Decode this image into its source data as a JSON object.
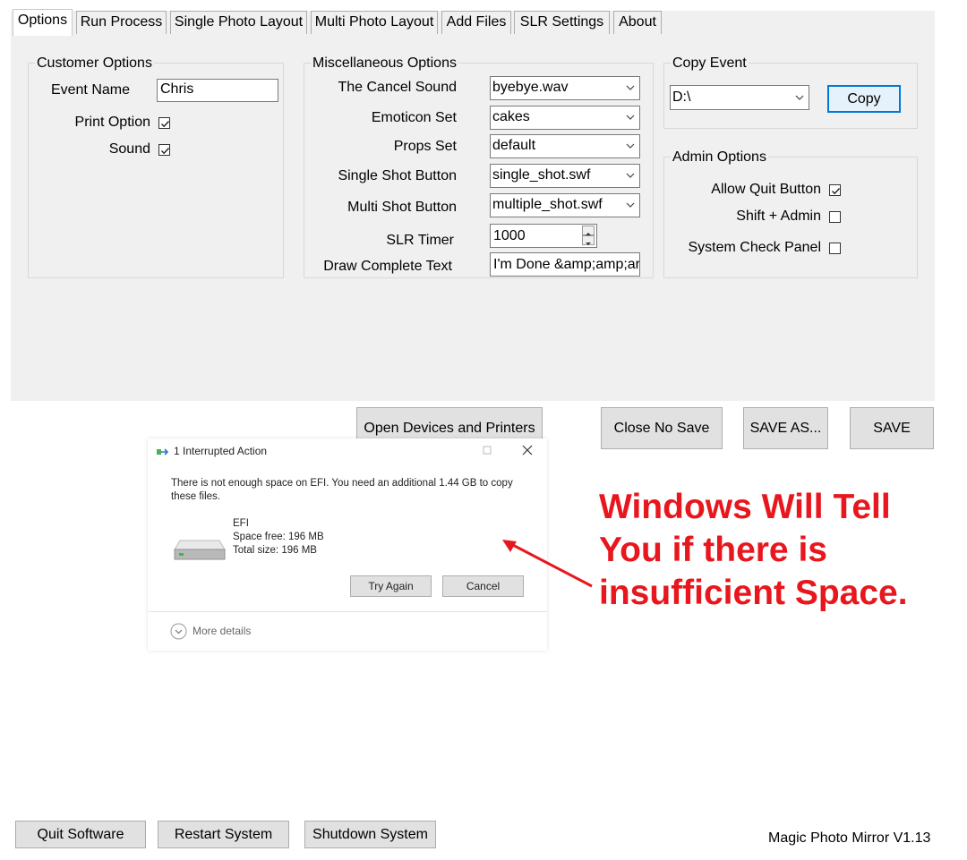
{
  "tabs": [
    {
      "label": "Options",
      "active": true
    },
    {
      "label": "Run Process"
    },
    {
      "label": "Single Photo Layout"
    },
    {
      "label": "Multi Photo Layout"
    },
    {
      "label": "Add Files"
    },
    {
      "label": "SLR Settings"
    },
    {
      "label": "About"
    }
  ],
  "customer_options": {
    "title": "Customer Options",
    "event_name_label": "Event Name",
    "event_name_value": "Chris",
    "print_option_label": "Print Option",
    "print_option_checked": true,
    "sound_label": "Sound",
    "sound_checked": true
  },
  "misc_options": {
    "title": "Miscellaneous Options",
    "cancel_sound_label": "The Cancel Sound",
    "cancel_sound_value": "byebye.wav",
    "emoticon_label": "Emoticon Set",
    "emoticon_value": "cakes",
    "props_label": "Props Set",
    "props_value": "default",
    "single_shot_label": "Single Shot Button",
    "single_shot_value": "single_shot.swf",
    "multi_shot_label": "Multi Shot Button",
    "multi_shot_value": "multiple_shot.swf",
    "slr_timer_label": "SLR Timer",
    "slr_timer_value": "1000",
    "draw_complete_label": "Draw Complete Text",
    "draw_complete_value": "I'm Done &amp;amp;ar"
  },
  "copy_event": {
    "title": "Copy Event",
    "drive_value": "D:\\",
    "copy_label": "Copy"
  },
  "admin_options": {
    "title": "Admin Options",
    "allow_quit_label": "Allow Quit Button",
    "allow_quit_checked": true,
    "shift_admin_label": "Shift + Admin",
    "shift_admin_checked": false,
    "system_check_label": "System Check Panel",
    "system_check_checked": false
  },
  "actions": {
    "open_devices_label": "Open Devices and Printers",
    "close_no_save_label": "Close No Save",
    "save_as_label": "SAVE AS...",
    "save_label": "SAVE"
  },
  "dialog": {
    "title": "1 Interrupted Action",
    "message": "There is not enough space on EFI. You need an additional 1.44 GB to copy these files.",
    "drive_name": "EFI",
    "space_free": "Space free: 196 MB",
    "total_size": "Total size: 196 MB",
    "try_again_label": "Try Again",
    "cancel_label": "Cancel",
    "more_details_label": "More details"
  },
  "annotation": {
    "lines": [
      "Windows Will Tell",
      "You if there is",
      "insufficient Space."
    ],
    "color": "#e8161d"
  },
  "footer": {
    "quit_label": "Quit Software",
    "restart_label": "Restart System",
    "shutdown_label": "Shutdown System",
    "version": "Magic Photo Mirror V1.13"
  }
}
